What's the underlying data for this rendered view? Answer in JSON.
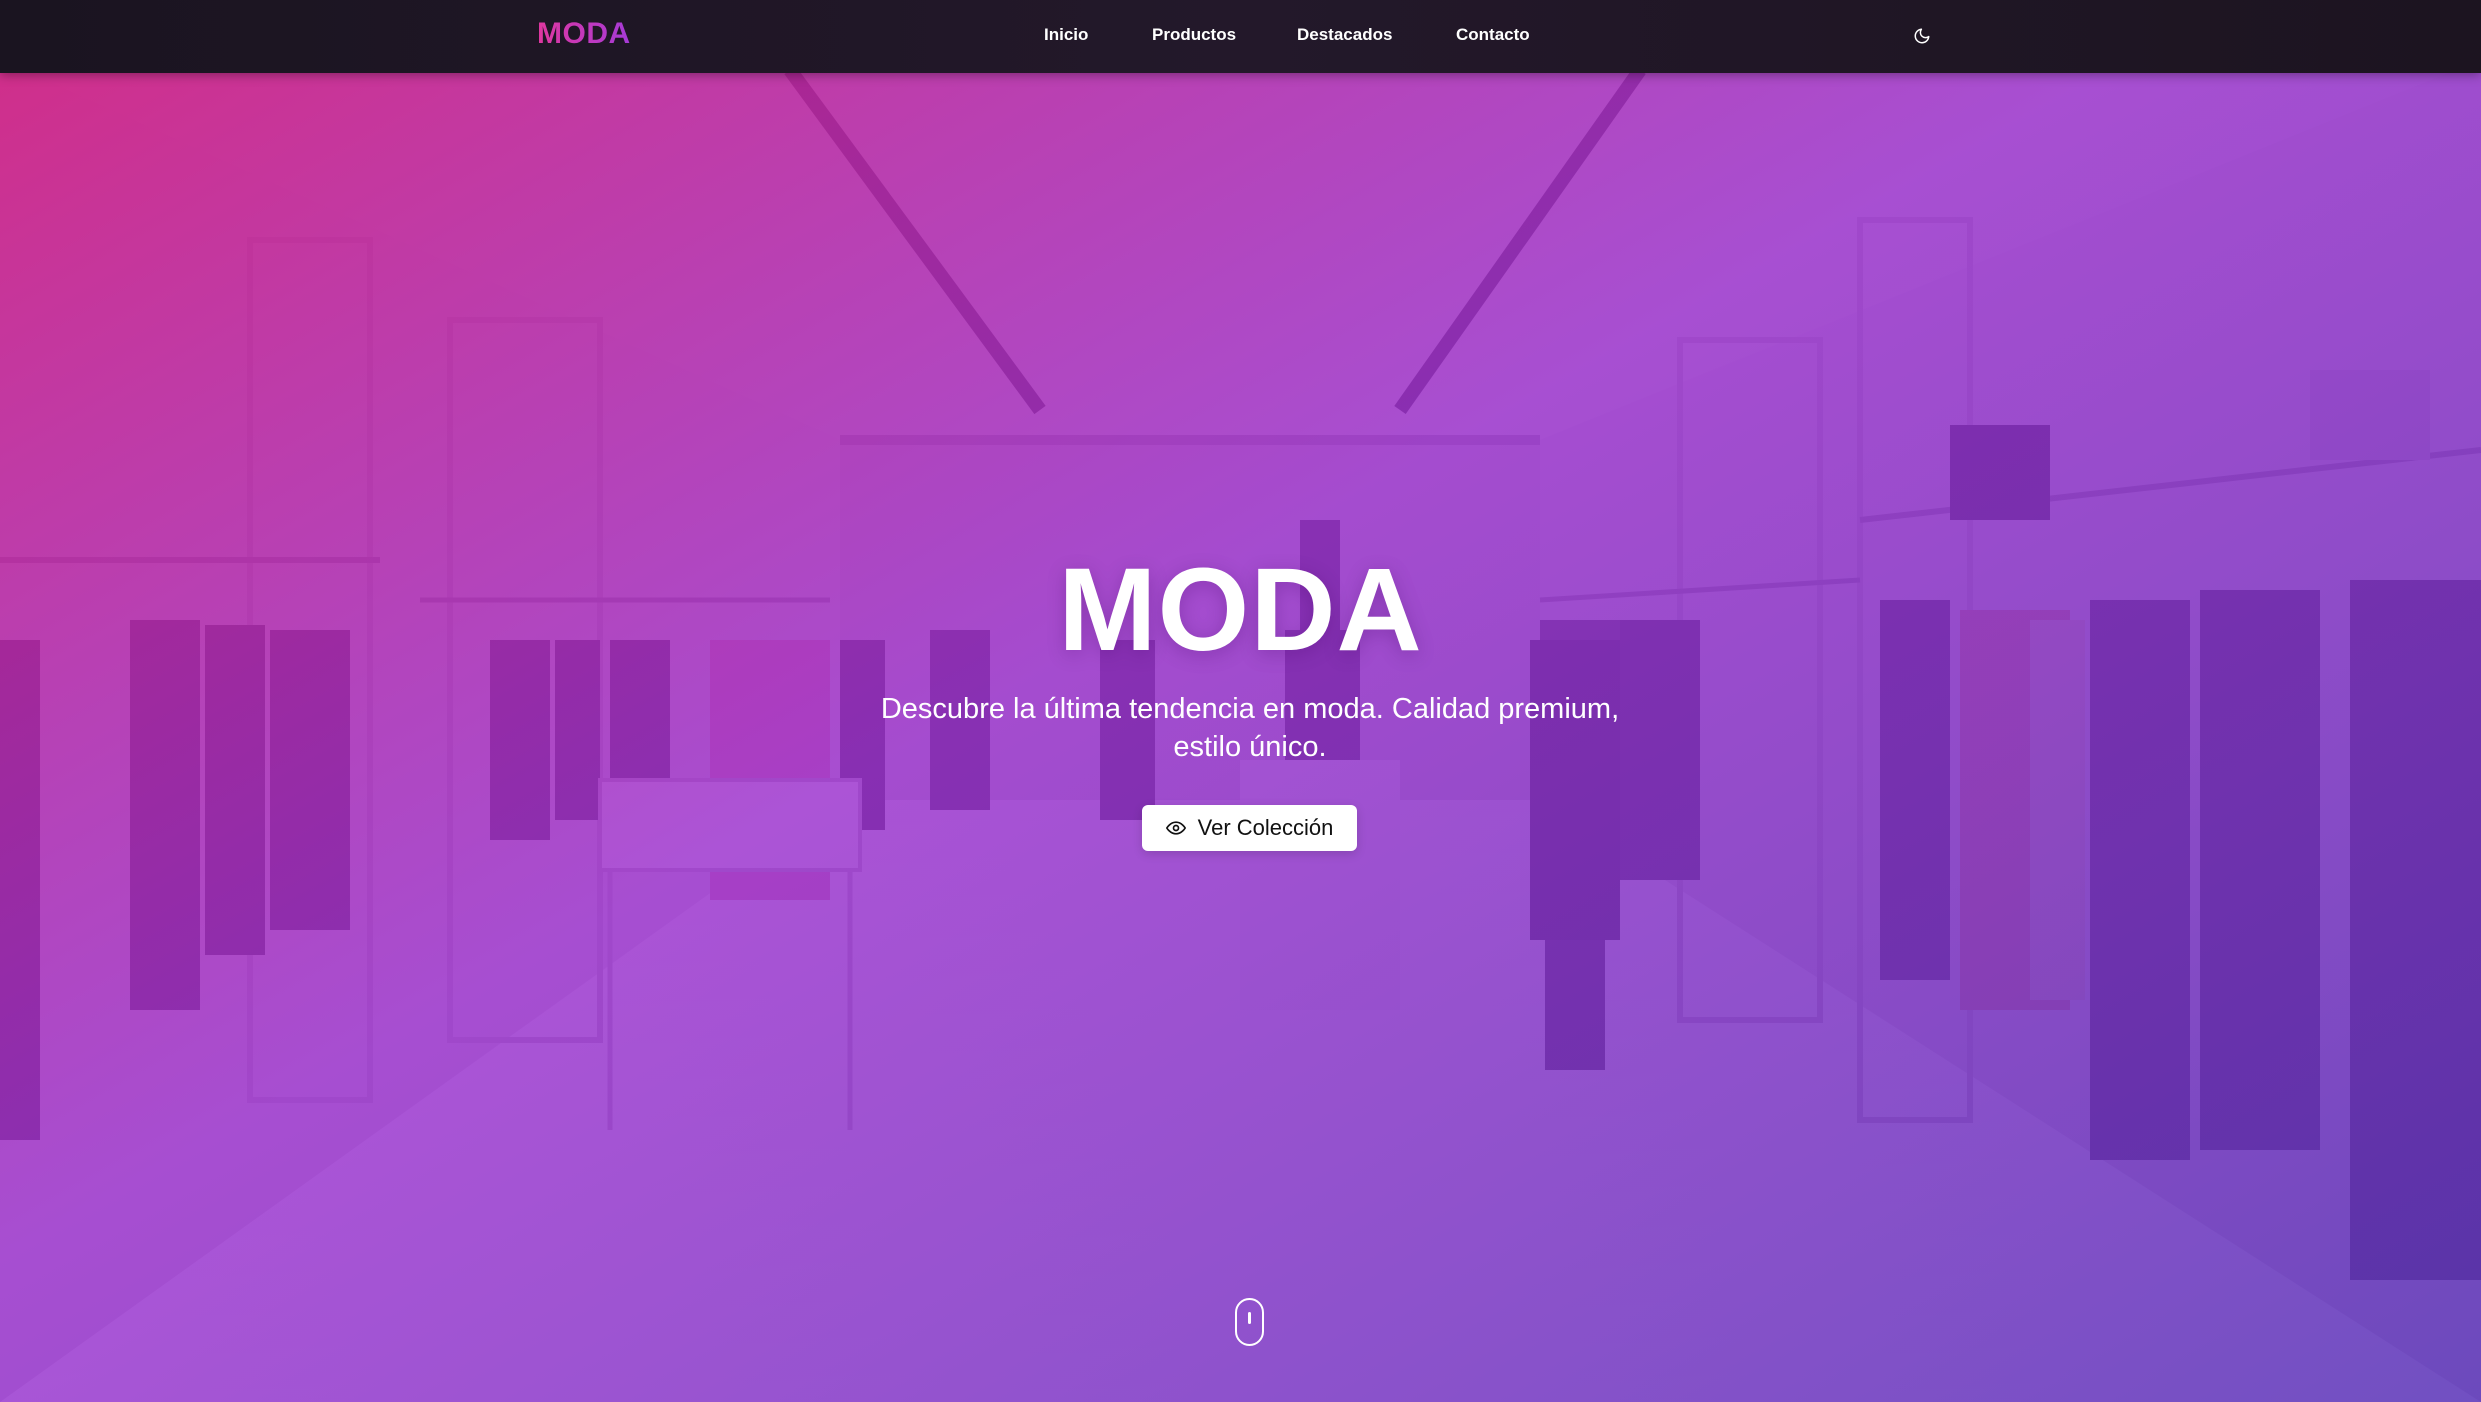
{
  "nav": {
    "logo": "MODA",
    "links": [
      {
        "label": "Inicio"
      },
      {
        "label": "Productos"
      },
      {
        "label": "Destacados"
      },
      {
        "label": "Contacto"
      }
    ],
    "theme_toggle_icon": "moon-icon"
  },
  "hero": {
    "title": "MODA",
    "subtitle": "Descubre la última tendencia en moda. Calidad premium, estilo único.",
    "cta_label": "Ver Colección",
    "cta_icon": "eye-icon",
    "scroll_icon": "mouse-scroll-icon",
    "background_image": "clothing-store-interior-photo",
    "overlay_colors": [
      "#d02a87",
      "#8a2bd6",
      "#5a3ab8"
    ]
  }
}
